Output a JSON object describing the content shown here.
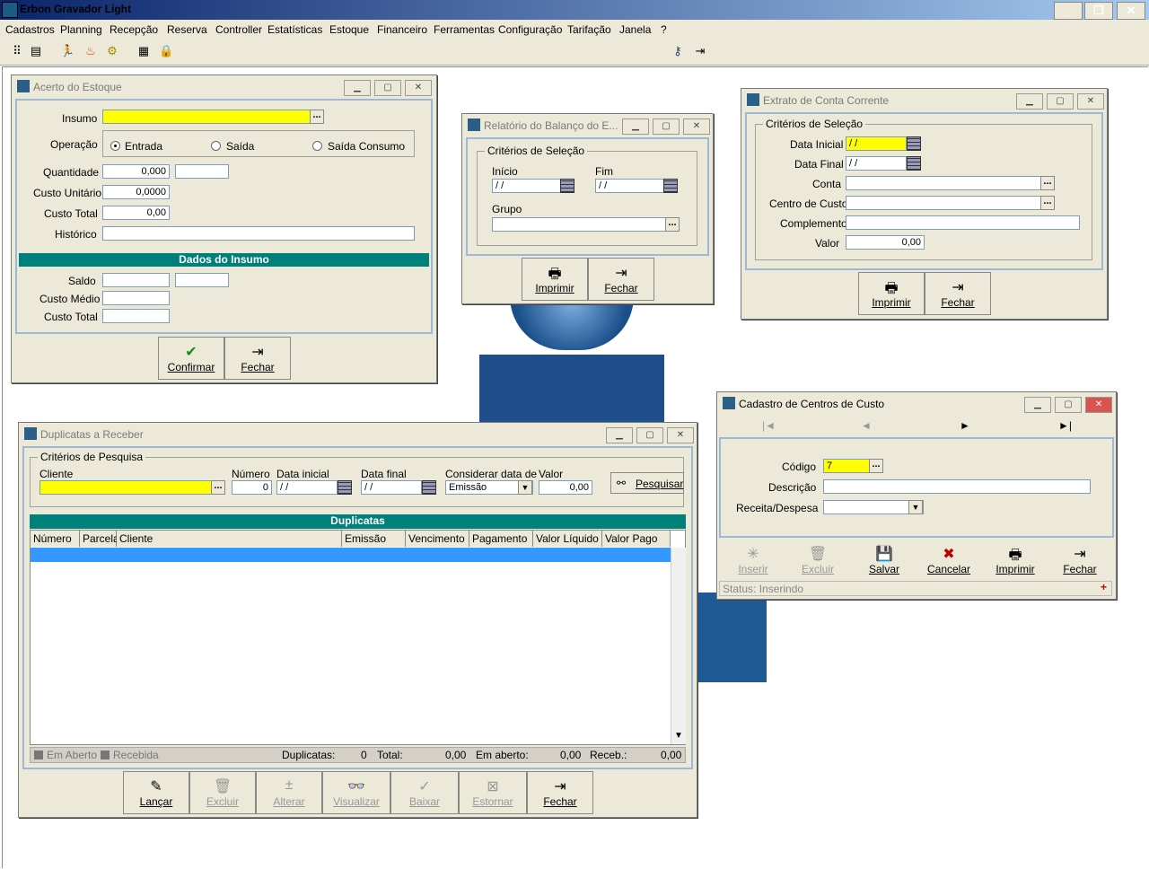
{
  "app": {
    "title": "Erbon Gravador Light"
  },
  "menu": [
    "Cadastros",
    "Planning",
    "Recepção",
    "Reserva",
    "Controller",
    "Estatísticas",
    "Estoque",
    "Financeiro",
    "Ferramentas",
    "Configuração",
    "Tarifação",
    "Janela",
    "?"
  ],
  "icons": {
    "toolbar": [
      "tree-icon",
      "card-icon",
      "runner-icon",
      "flame-icon",
      "gear-icon",
      "calendar-icon",
      "lock-icon",
      "key-icon",
      "exit-icon"
    ]
  },
  "acerto": {
    "title": "Acerto do Estoque",
    "insumo_label": "Insumo",
    "operacao_label": "Operação",
    "op_entrada": "Entrada",
    "op_saida": "Saída",
    "op_saida_consumo": "Saída Consumo",
    "quantidade_label": "Quantidade",
    "quantidade": "0,000",
    "custo_unit_label": "Custo Unitário",
    "custo_unit": "0,0000",
    "custo_total_label": "Custo Total",
    "custo_total": "0,00",
    "historico_label": "Histórico",
    "dados_header": "Dados do Insumo",
    "saldo_label": "Saldo",
    "custo_medio_label": "Custo Médio",
    "custo_total2_label": "Custo Total",
    "confirmar": "Confirmar",
    "fechar": "Fechar"
  },
  "balanco": {
    "title": "Relatório do Balanço do E...",
    "group": "Critérios de Seleção",
    "inicio_label": "Início",
    "inicio": " / /",
    "fim_label": "Fim",
    "fim": " / /",
    "grupo_label": "Grupo",
    "imprimir": "Imprimir",
    "fechar": "Fechar"
  },
  "extrato": {
    "title": "Extrato de Conta Corrente",
    "group": "Critérios de Seleção",
    "data_inicial_label": "Data Inicial",
    "data_inicial": " / /",
    "data_final_label": "Data Final",
    "data_final": " / /",
    "conta_label": "Conta",
    "centro_label": "Centro de Custo",
    "complemento_label": "Complemento",
    "valor_label": "Valor",
    "valor": "0,00",
    "imprimir": "Imprimir",
    "fechar": "Fechar"
  },
  "centros": {
    "title": "Cadastro de Centros de Custo",
    "nav": [
      "|◄",
      "◄",
      "►",
      "►|"
    ],
    "codigo_label": "Código",
    "codigo": "7",
    "descricao_label": "Descrição",
    "receita_label": "Receita/Despesa",
    "btn_inserir": "Inserir",
    "btn_excluir": "Excluir",
    "btn_salvar": "Salvar",
    "btn_cancelar": "Cancelar",
    "btn_imprimir": "Imprimir",
    "btn_fechar": "Fechar",
    "status": "Status: Inserindo"
  },
  "duplicatas": {
    "title": "Duplicatas a Receber",
    "group": "Critérios de Pesquisa",
    "cliente_label": "Cliente",
    "numero_label": "Número",
    "numero": "0",
    "data_inicial_label": "Data inicial",
    "data_inicial": " / /",
    "data_final_label": "Data final",
    "data_final": " / /",
    "considerar_label": "Considerar data de",
    "considerar": "Emissão",
    "valor_label": "Valor",
    "valor": "0,00",
    "pesquisar": "Pesquisar",
    "grid_header": "Duplicatas",
    "columns": [
      "Número",
      "Parcela",
      "Cliente",
      "Emissão",
      "Vencimento",
      "Pagamento",
      "Valor Líquido",
      "Valor Pago"
    ],
    "legend_aberto": "Em Aberto",
    "legend_recebida": "Recebida",
    "dup_label": "Duplicatas:",
    "dup_count": "0",
    "total_label": "Total:",
    "total": "0,00",
    "aberto_label": "Em aberto:",
    "aberto": "0,00",
    "receb_label": "Receb.:",
    "receb": "0,00",
    "btn_lancar": "Lançar",
    "btn_excluir": "Excluir",
    "btn_alterar": "Alterar",
    "btn_visualizar": "Visualizar",
    "btn_baixar": "Baixar",
    "btn_estornar": "Estornar",
    "btn_fechar": "Fechar"
  }
}
